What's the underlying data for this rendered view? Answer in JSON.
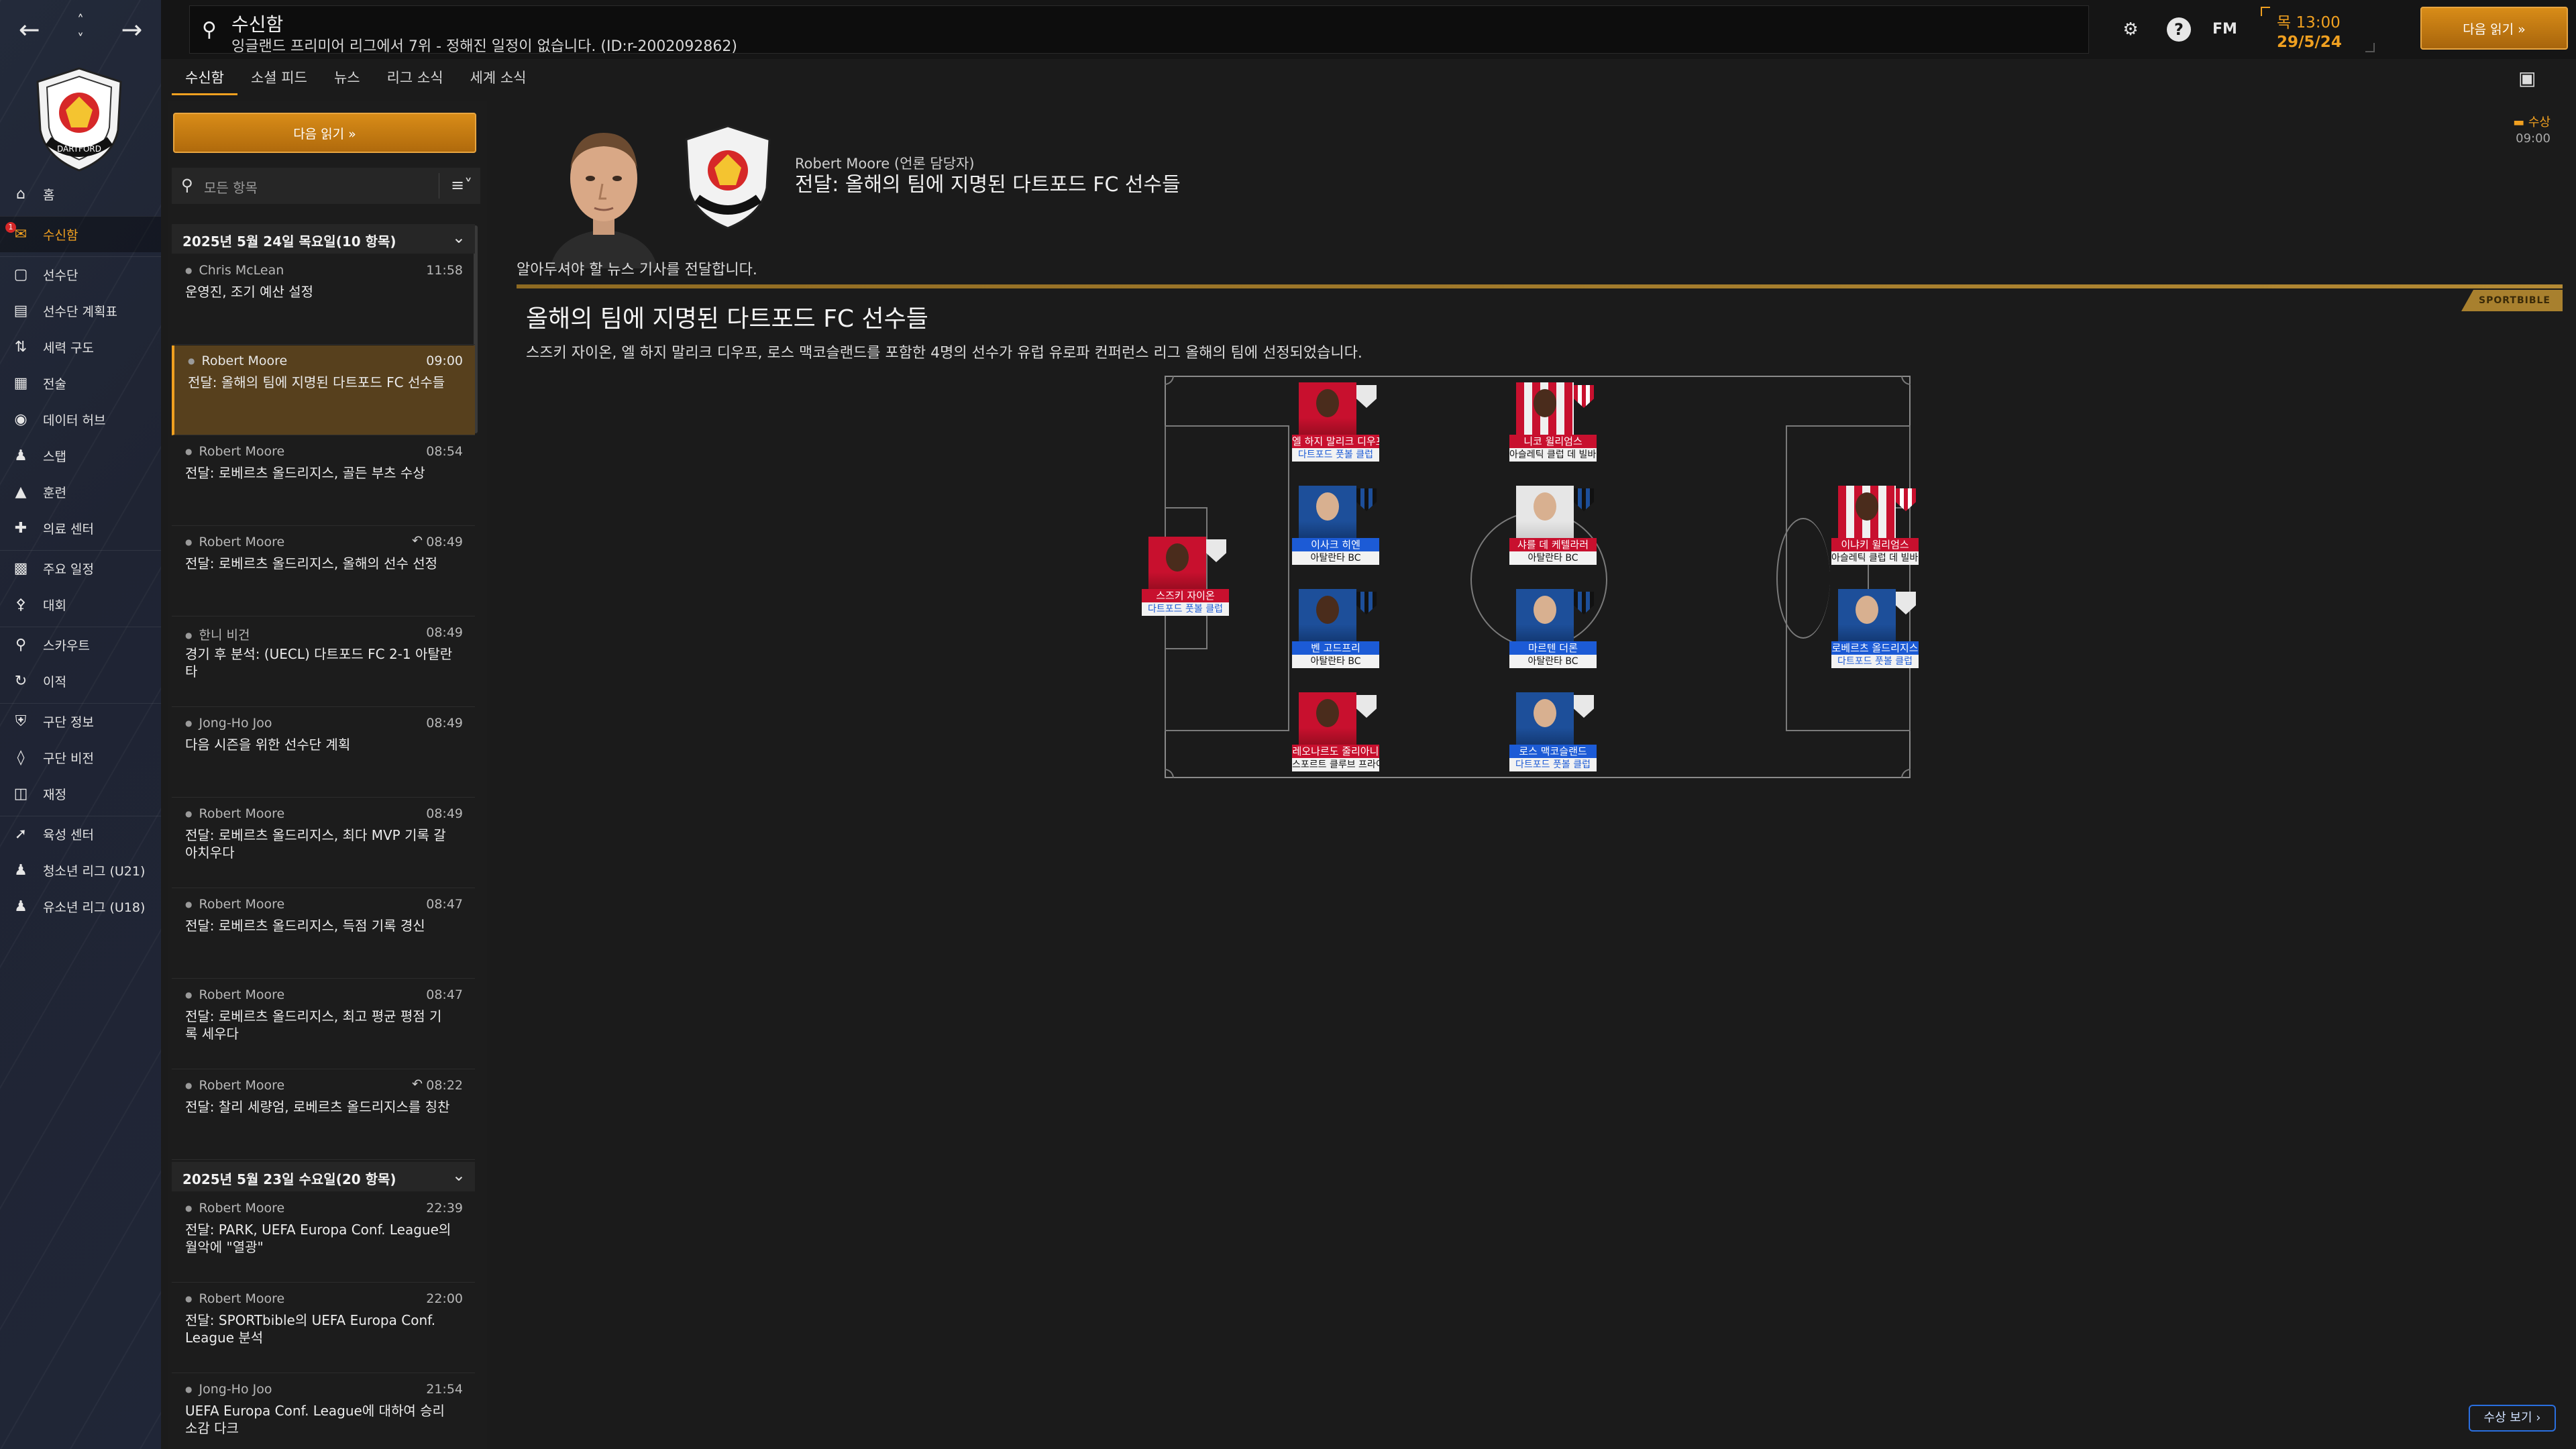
{
  "sidebar": {
    "items": [
      {
        "label": "홈",
        "icon": "home-icon"
      },
      {
        "label": "수신함",
        "icon": "inbox-icon",
        "badge": "1"
      },
      {
        "label": "선수단",
        "icon": "shirt-icon"
      },
      {
        "label": "선수단 계획표",
        "icon": "clipboard-icon"
      },
      {
        "label": "세력 구도",
        "icon": "dynamics-icon"
      },
      {
        "label": "전술",
        "icon": "tactics-icon"
      },
      {
        "label": "데이터 허브",
        "icon": "data-hub-icon"
      },
      {
        "label": "스탭",
        "icon": "staff-icon"
      },
      {
        "label": "훈련",
        "icon": "training-icon"
      },
      {
        "label": "의료 센터",
        "icon": "medical-icon"
      },
      {
        "label": "주요 일정",
        "icon": "calendar-icon"
      },
      {
        "label": "대회",
        "icon": "trophy-icon"
      },
      {
        "label": "스카우트",
        "icon": "scouting-icon"
      },
      {
        "label": "이적",
        "icon": "transfers-icon"
      },
      {
        "label": "구단 정보",
        "icon": "club-info-icon"
      },
      {
        "label": "구단 비전",
        "icon": "club-vision-icon"
      },
      {
        "label": "재정",
        "icon": "finances-icon"
      },
      {
        "label": "육성 센터",
        "icon": "dev-centre-icon"
      },
      {
        "label": "청소년 리그 (U21)",
        "icon": "youth-u21-icon"
      },
      {
        "label": "유소년 리그 (U18)",
        "icon": "youth-u18-icon"
      }
    ]
  },
  "topbar": {
    "title": "수신함",
    "subtitle": "잉글랜드 프리미어 리그에서 7위 - 정해진 일정이 없습니다. (ID:r-2002092862)",
    "fm_label": "FM",
    "day_time": "목 13:00",
    "date": "29/5/24",
    "continue_label": "다음 읽기 »"
  },
  "tabs": [
    "수신함",
    "소셜 피드",
    "뉴스",
    "리그 소식",
    "세계 소식"
  ],
  "inbox": {
    "continue_label": "다음 읽기 »",
    "filter_text": "모든 항목",
    "groups": [
      {
        "header": "2025년 5월 24일 목요일(10 항목)",
        "messages": [
          {
            "sender": "Chris McLean",
            "time": "11:58",
            "subject": "운영진, 조기 예산 설정"
          },
          {
            "sender": "Robert Moore",
            "time": "09:00",
            "subject": "전달: 올해의 팀에 지명된 다트포드 FC 선수들"
          },
          {
            "sender": "Robert Moore",
            "time": "08:54",
            "subject": "전달: 로베르츠 올드리지스, 골든 부츠 수상"
          },
          {
            "sender": "Robert Moore",
            "time": "08:49",
            "subject": "전달: 로베르츠 올드리지스, 올해의 선수 선정"
          },
          {
            "sender": "한니 비건",
            "time": "08:49",
            "subject": "경기 후 분석: (UECL) 다트포드 FC 2-1 아탈란타"
          },
          {
            "sender": "Jong-Ho Joo",
            "time": "08:49",
            "subject": "다음 시즌을 위한 선수단 계획"
          },
          {
            "sender": "Robert Moore",
            "time": "08:49",
            "subject": "전달: 로베르츠 올드리지스, 최다 MVP 기록 갈아치우다"
          },
          {
            "sender": "Robert Moore",
            "time": "08:47",
            "subject": "전달: 로베르츠 올드리지스, 득점 기록 경신"
          },
          {
            "sender": "Robert Moore",
            "time": "08:47",
            "subject": "전달: 로베르츠 올드리지스, 최고 평균 평점 기록 세우다"
          },
          {
            "sender": "Robert Moore",
            "time": "08:22",
            "subject": "전달: 찰리 세량엄, 로베르츠 올드리지스를 칭찬"
          }
        ]
      },
      {
        "header": "2025년 5월 23일 수요일(20 항목)",
        "messages": [
          {
            "sender": "Robert Moore",
            "time": "22:39",
            "subject": "전달: PARK, UEFA Europa Conf. League의 월악에 \"열광\""
          },
          {
            "sender": "Robert Moore",
            "time": "22:00",
            "subject": "전달: SPORTbible의 UEFA Europa Conf. League 분석"
          },
          {
            "sender": "Jong-Ho Joo",
            "time": "21:54",
            "subject": "UEFA Europa Conf. League에 대하여 승리 소감 다크"
          }
        ]
      }
    ]
  },
  "article": {
    "from": "Robert Moore (언론 담당자)",
    "headline": "전달: 올해의 팀에 지명된 다트포드 FC 선수들",
    "award_badge": "수상",
    "award_time": "09:00",
    "intro": "알아두셔야 할 뉴스 기사를 전달합니다.",
    "source": "SPORTBIBLE",
    "title": "올해의 팀에 지명된 다트포드 FC 선수들",
    "body": "스즈키 자이온, 엘 하지 말리크 디우프, 로스 맥코슬랜드를 포함한 4명의 선수가 유럽 유로파 컨퍼런스 리그 올해의 팀에 선정되었습니다.",
    "award_button": "수상 보기 ›",
    "players": [
      {
        "name": "스즈키 자이온",
        "club": "다트포드 풋볼 클럽",
        "style": "red",
        "clubstyle": "bluetxt"
      },
      {
        "name": "엘 하지 말리크 디우프",
        "club": "다트포드 풋볼 클럽",
        "style": "red",
        "clubstyle": "bluetxt"
      },
      {
        "name": "이사크 히엔",
        "club": "아탈란타 BC",
        "style": "blue",
        "clubstyle": ""
      },
      {
        "name": "벤 고드프리",
        "club": "아탈란타 BC",
        "style": "blue",
        "clubstyle": ""
      },
      {
        "name": "레오나르도 줄리아니",
        "club": "스포르트 클루브 프라이...",
        "style": "red",
        "clubstyle": ""
      },
      {
        "name": "니코 윌리엄스",
        "club": "아슬레틱 클럽 데 빌바오",
        "style": "red",
        "clubstyle": ""
      },
      {
        "name": "샤를 데 케텔라러",
        "club": "아탈란타 BC",
        "style": "blue",
        "clubstyle": ""
      },
      {
        "name": "마르텐 더론",
        "club": "아탈란타 BC",
        "style": "blue",
        "clubstyle": ""
      },
      {
        "name": "로스 맥코슬랜드",
        "club": "다트포드 풋볼 클럽",
        "style": "blue",
        "clubstyle": "bluetxt"
      },
      {
        "name": "이냐키 윌리엄스",
        "club": "아슬레틱 클럽 데 빌바오",
        "style": "red",
        "clubstyle": ""
      },
      {
        "name": "로베르츠 올드리지스",
        "club": "다트포드 풋볼 클럽",
        "style": "blue",
        "clubstyle": "bluetxt"
      }
    ]
  },
  "colors": {
    "accent": "#f0a020",
    "link_blue": "#2a6fe0",
    "selected_bg": "#57401d"
  }
}
